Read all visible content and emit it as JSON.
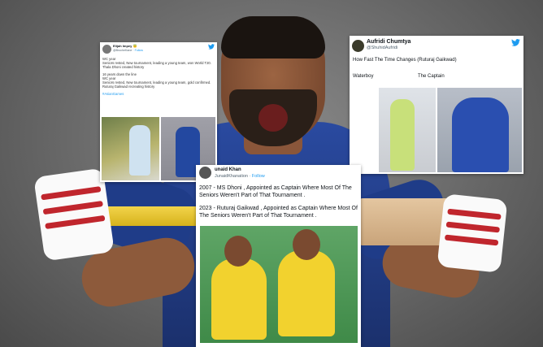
{
  "tweet1": {
    "name": "Elijah Impey 😇",
    "handle": "@BrocheKane",
    "follow": "Follow",
    "paragraph1": "WC year\nSeniors rested, New tournament, leading a young team, won World T20. Thala Dhoni created history",
    "paragraph2": "16 years down the line\nWC year\nSeniors rested, New tournament, leading a young team, gold confirmed. Ruturaj Gaikwad recreating history",
    "hashtag": "#AsianGames"
  },
  "tweet2": {
    "name": "Aufridi Chumtya",
    "handle": "@ShuhidAufridi",
    "text": "How Fast The Time Changes (Ruturaj Gaikwad)",
    "label_left": "Waterboy",
    "label_right": "The Captain"
  },
  "tweet3": {
    "name": "unaid Khan",
    "handle": "JunaidKhanation",
    "follow": "Follow",
    "paragraph1": "2007 - MS Dhoni , Appointed as Captain Where Most Of The Seniors Weren't Part of That Tournament .",
    "paragraph2": "2023 - Ruturaj Gaikwad , Appointed as Captain Where Most Of The Seniors Weren't Part of That Tournament ."
  },
  "icons": {
    "twitter": "twitter-bird-icon"
  }
}
